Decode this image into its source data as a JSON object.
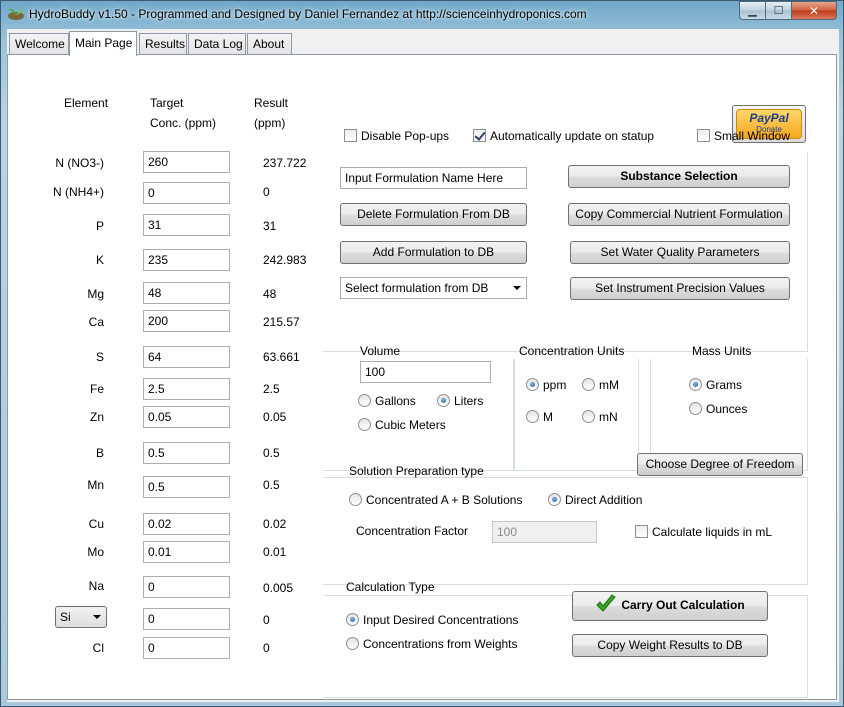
{
  "window": {
    "title": "HydroBuddy v1.50 - Programmed and Designed by Daniel Fernandez at http://scienceinhydroponics.com"
  },
  "tabs": [
    {
      "label": "Welcome"
    },
    {
      "label": "Main Page"
    },
    {
      "label": "Results"
    },
    {
      "label": "Data Log"
    },
    {
      "label": "About"
    }
  ],
  "headers": {
    "element": "Element",
    "target_line1": "Target",
    "target_line2": "Conc. (ppm)",
    "result_line1": "Result",
    "result_line2": "(ppm)"
  },
  "elements": [
    {
      "name": "N (NO3-)",
      "target": "260",
      "result": "237.722"
    },
    {
      "name": "N (NH4+)",
      "target": "0",
      "result": "0"
    },
    {
      "name": "P",
      "target": "31",
      "result": "31"
    },
    {
      "name": "K",
      "target": "235",
      "result": "242.983"
    },
    {
      "name": "Mg",
      "target": "48",
      "result": "48"
    },
    {
      "name": "Ca",
      "target": "200",
      "result": "215.57"
    },
    {
      "name": "S",
      "target": "64",
      "result": "63.661"
    },
    {
      "name": "Fe",
      "target": "2.5",
      "result": "2.5"
    },
    {
      "name": "Zn",
      "target": "0.05",
      "result": "0.05"
    },
    {
      "name": "B",
      "target": "0.5",
      "result": "0.5"
    },
    {
      "name": "Mn",
      "target": "0.5",
      "result": "0.5"
    },
    {
      "name": "Cu",
      "target": "0.02",
      "result": "0.02"
    },
    {
      "name": "Mo",
      "target": "0.01",
      "result": "0.01"
    },
    {
      "name": "Na",
      "target": "0",
      "result": "0.005"
    },
    {
      "name": "Si",
      "target": "0",
      "result": "0"
    },
    {
      "name": "Cl",
      "target": "0",
      "result": "0"
    }
  ],
  "paypal": {
    "logo": "PayPal",
    "donate": "Donate"
  },
  "options": {
    "disable_popups": {
      "label": "Disable Pop-ups",
      "checked": false
    },
    "auto_update": {
      "label": "Automatically update on statup",
      "checked": true
    },
    "small_window": {
      "label": "Small Window",
      "checked": false
    }
  },
  "formulation": {
    "name_value": "Input Formulation Name Here",
    "substance_selection": "Substance Selection",
    "delete_formulation": "Delete Formulation From DB",
    "copy_commercial": "Copy Commercial Nutrient Formulation",
    "add_formulation": "Add Formulation to DB",
    "set_water_quality": "Set Water Quality Parameters",
    "select_formulation": "Select formulation from DB",
    "set_instrument_precision": "Set Instrument Precision Values"
  },
  "volume": {
    "label": "Volume",
    "value": "100",
    "gallons": "Gallons",
    "liters": "Liters",
    "cubic_meters": "Cubic Meters",
    "selected": "Liters"
  },
  "concentration_units": {
    "label": "Concentration Units",
    "ppm": "ppm",
    "mM": "mM",
    "M": "M",
    "mN": "mN",
    "selected": "ppm"
  },
  "mass_units": {
    "label": "Mass Units",
    "grams": "Grams",
    "ounces": "Ounces",
    "selected": "Grams"
  },
  "solution_prep": {
    "label": "Solution Preparation type",
    "choose_degree": "Choose Degree of Freedom",
    "concentrated_ab": "Concentrated A + B Solutions",
    "direct_addition": "Direct Addition",
    "selected": "Direct Addition",
    "concentration_factor_label": "Concentration Factor",
    "concentration_factor_value": "100",
    "calc_liquids_ml": "Calculate liquids in mL"
  },
  "calculation": {
    "label": "Calculation Type",
    "input_desired": "Input Desired Concentrations",
    "from_weights": "Concentrations from  Weights",
    "selected": "Input Desired Concentrations",
    "carry_out": "Carry Out Calculation",
    "copy_weight_results": "Copy Weight Results to DB"
  },
  "colors": {
    "titlebar": "#9cc3da",
    "close_button": "#c84a28",
    "checkmark_green": "#3aa626",
    "paypal_gold": "#f7a81b"
  }
}
